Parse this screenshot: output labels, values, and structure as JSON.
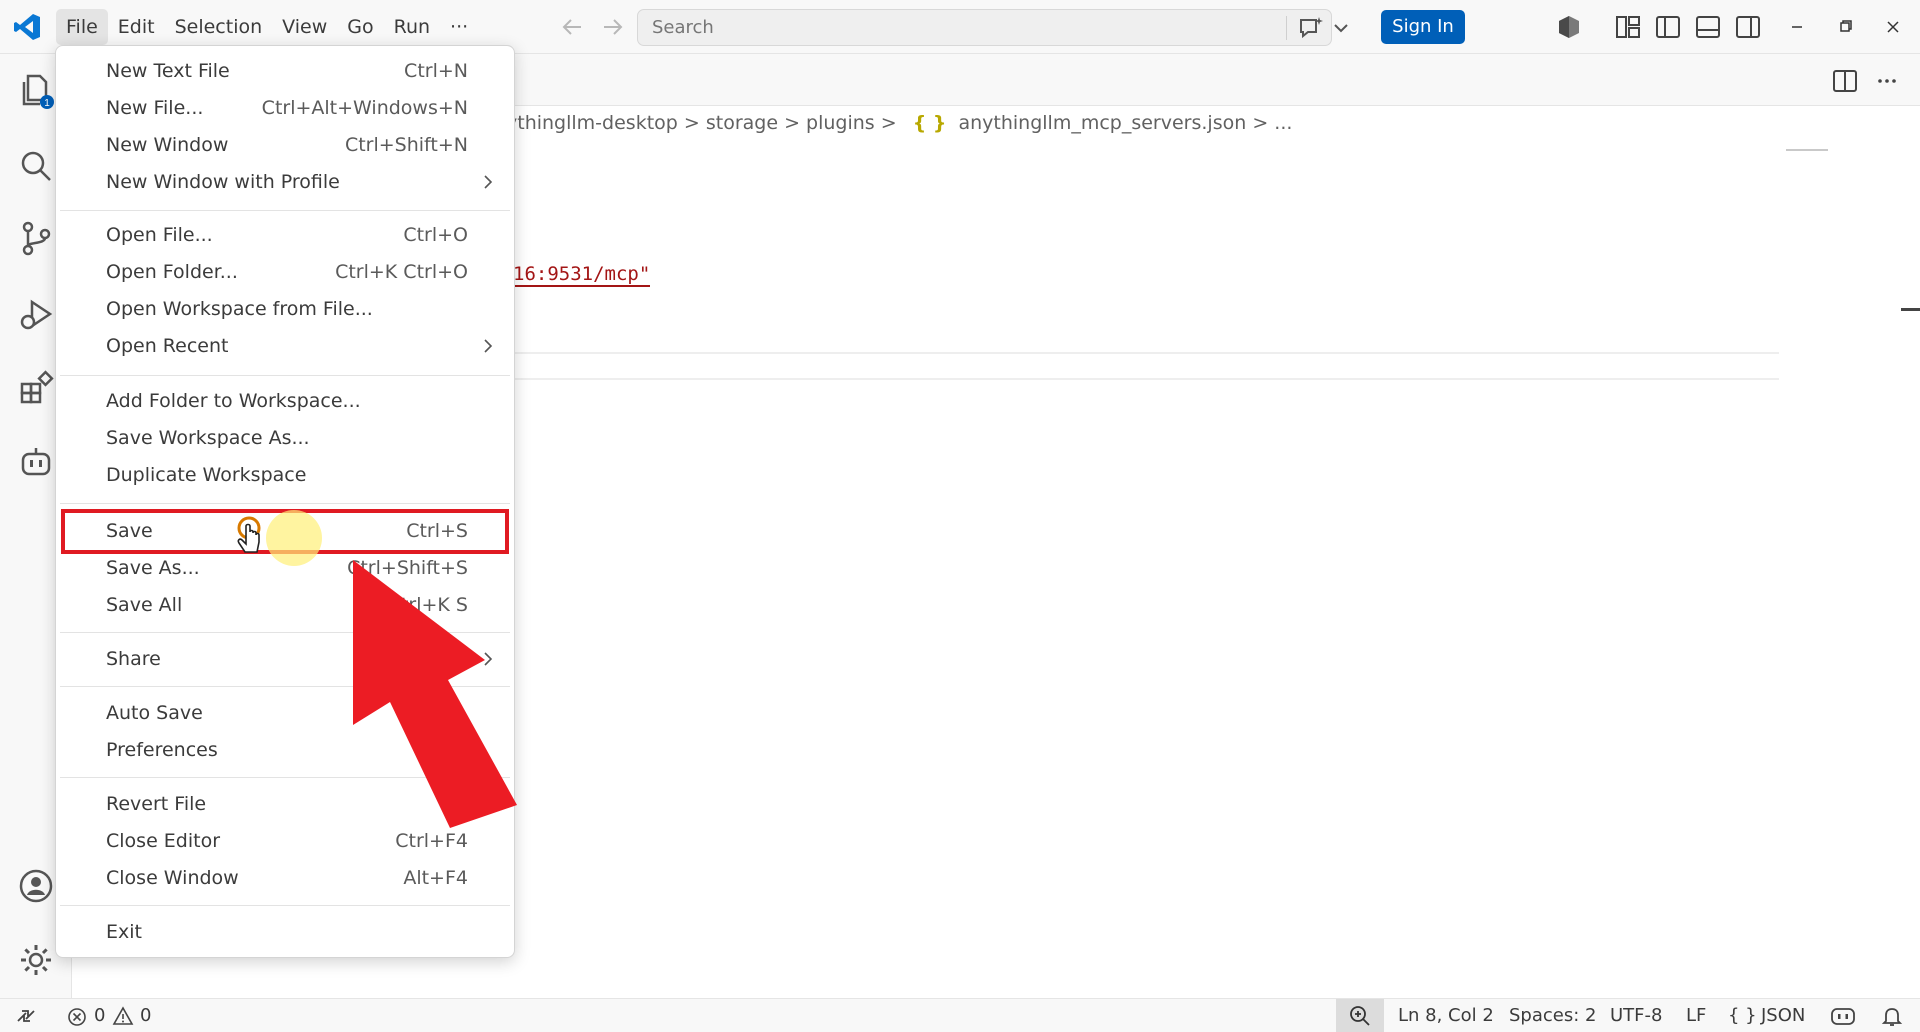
{
  "menubar": {
    "items": [
      "File",
      "Edit",
      "Selection",
      "View",
      "Go",
      "Run",
      "···"
    ]
  },
  "search": {
    "placeholder": "Search"
  },
  "signin": {
    "label": "Sign In"
  },
  "breadcrumb": {
    "seg1": "ythingllm-desktop",
    "seg2": "storage",
    "seg3": "plugins",
    "file_icon": "{ }",
    "file": "anythingllm_mcp_servers.json",
    "more": "..."
  },
  "editor": {
    "visible_line": "16:9531/mcp\""
  },
  "file_menu": {
    "items": [
      {
        "label": "New Text File",
        "shortcut": "Ctrl+N"
      },
      {
        "label": "New File...",
        "shortcut": "Ctrl+Alt+Windows+N"
      },
      {
        "label": "New Window",
        "shortcut": "Ctrl+Shift+N"
      },
      {
        "label": "New Window with Profile",
        "shortcut": ""
      },
      {
        "label": "Open File...",
        "shortcut": "Ctrl+O"
      },
      {
        "label": "Open Folder...",
        "shortcut": "Ctrl+K Ctrl+O"
      },
      {
        "label": "Open Workspace from File...",
        "shortcut": ""
      },
      {
        "label": "Open Recent",
        "shortcut": ""
      },
      {
        "label": "Add Folder to Workspace...",
        "shortcut": ""
      },
      {
        "label": "Save Workspace As...",
        "shortcut": ""
      },
      {
        "label": "Duplicate Workspace",
        "shortcut": ""
      },
      {
        "label": "Save",
        "shortcut": "Ctrl+S"
      },
      {
        "label": "Save As...",
        "shortcut": "Ctrl+Shift+S"
      },
      {
        "label": "Save All",
        "shortcut": "Ctrl+K S"
      },
      {
        "label": "Share",
        "shortcut": ""
      },
      {
        "label": "Auto Save",
        "shortcut": ""
      },
      {
        "label": "Preferences",
        "shortcut": ""
      },
      {
        "label": "Revert File",
        "shortcut": ""
      },
      {
        "label": "Close Editor",
        "shortcut": "Ctrl+F4"
      },
      {
        "label": "Close Window",
        "shortcut": "Alt+F4"
      },
      {
        "label": "Exit",
        "shortcut": ""
      }
    ]
  },
  "statusbar": {
    "errors": "0",
    "warnings": "0",
    "position": "Ln 8, Col 2",
    "spaces": "Spaces: 2",
    "encoding": "UTF-8",
    "eol": "LF",
    "language_icon": "{ }",
    "language": "JSON"
  },
  "colors": {
    "accent": "#005fb8",
    "highlight_box": "#e01a22",
    "arrow": "#ec1c24",
    "string": "#a31515"
  }
}
